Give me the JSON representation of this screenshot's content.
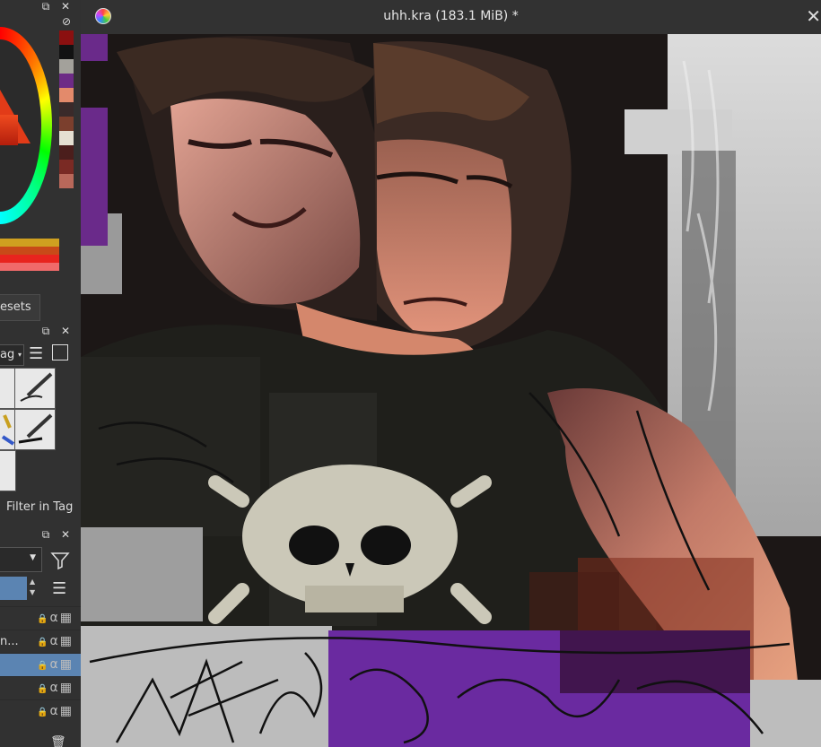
{
  "document": {
    "title": "uhh.kra (183.1 MiB) *",
    "close_glyph": "✕"
  },
  "docker_controls": {
    "float_glyph": "⧉",
    "close_glyph": "✕",
    "no_color_glyph": "⊘"
  },
  "color_selector": {
    "swatches": [
      "#8b1010",
      "#121212",
      "#a3a19b",
      "#6d2b86",
      "#e38a6b",
      "#3a2a2a",
      "#7b3f2d",
      "#e5dfd2",
      "#4b1e1c",
      "#7a2a24",
      "#b9685a"
    ],
    "bars": [
      "#cfa020",
      "#c84a18",
      "#e8241e",
      "#f06a6a"
    ]
  },
  "brush_presets": {
    "tab_label": "esets",
    "tag_label": "ag",
    "filter_label": "Filter in Tag"
  },
  "layers": {
    "rows": [
      {
        "name": "",
        "selected": false
      },
      {
        "name": "n...",
        "selected": false
      },
      {
        "name": "",
        "selected": true
      },
      {
        "name": "",
        "selected": false
      },
      {
        "name": "",
        "selected": false
      }
    ],
    "alpha_glyph": "α"
  }
}
